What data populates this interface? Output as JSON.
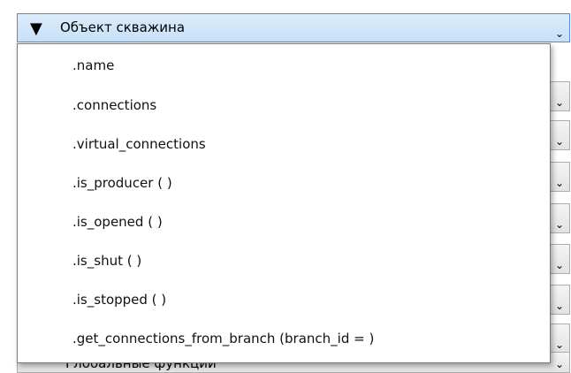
{
  "combo": {
    "selected": "Объект скважина",
    "expand_glyph": "▼",
    "arrow_glyph": "⌄"
  },
  "background_partial_text": "Глобальные функции",
  "popup": {
    "items": [
      ".name",
      ".connections",
      ".virtual_connections",
      ".is_producer ( )",
      ".is_opened ( )",
      ".is_shut ( )",
      ".is_stopped ( )",
      ".get_connections_from_branch (branch_id = )"
    ]
  }
}
